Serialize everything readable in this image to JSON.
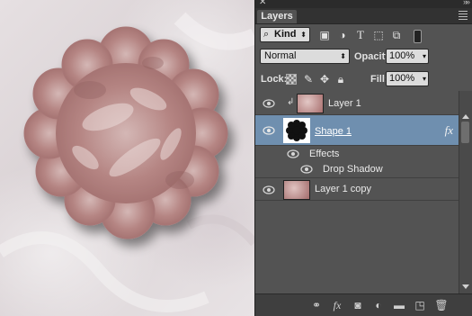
{
  "panel": {
    "tab_label": "Layers",
    "filter": {
      "kind_label": "Kind",
      "search_glyph": "⌕"
    },
    "blend_mode": "Normal",
    "opacity_label": "Opacity:",
    "opacity_value": "100%",
    "lock_label": "Lock:",
    "fill_label": "Fill:",
    "fill_value": "100%"
  },
  "layers": [
    {
      "name": "Layer 1",
      "visible": true,
      "clipped": true,
      "type": "pixel-photo"
    },
    {
      "name": "Shape 1",
      "visible": true,
      "selected": true,
      "type": "shape",
      "fx_badge": "fx"
    },
    {
      "name": "Effects",
      "visible": true,
      "type": "effects-group"
    },
    {
      "name": "Drop Shadow",
      "visible": true,
      "type": "effect"
    },
    {
      "name": "Layer 1 copy",
      "visible": true,
      "type": "pixel-photo"
    }
  ],
  "bottom_icons": [
    "link-icon",
    "fx-icon",
    "mask-icon",
    "adjustment-icon",
    "group-folder-icon",
    "new-layer-icon",
    "trash-icon"
  ],
  "bottom_fx_label": "fx",
  "colors": {
    "panel_bg": "#535353",
    "selected_row": "#6f8faf",
    "canvas_bg": "#e2dcde",
    "flower": "#b88886"
  }
}
